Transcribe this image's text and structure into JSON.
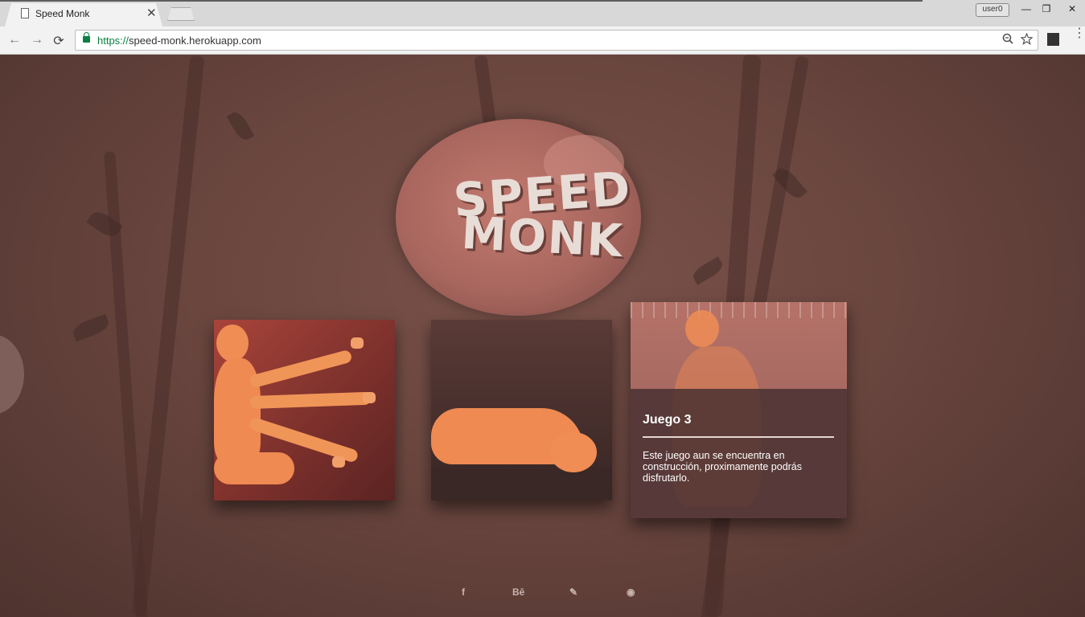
{
  "browser": {
    "tab_title": "Speed Monk",
    "tab_close": "✕",
    "user_badge": "user0",
    "window_controls": {
      "minimize": "—",
      "restore": "❐",
      "close": "✕"
    },
    "nav": {
      "back": "←",
      "forward": "→",
      "reload": "⟳"
    },
    "url_scheme": "https://",
    "url_rest": "speed-monk.herokuapp.com",
    "zoom_icon": "zoom-icon",
    "star_icon": "star-icon",
    "menu_icon": "⋮"
  },
  "logo": {
    "line1": "SPEED",
    "line2": "MONK"
  },
  "cards": [
    {
      "id": "juego-1"
    },
    {
      "id": "juego-2"
    },
    {
      "id": "juego-3",
      "title": "Juego 3",
      "description": "Este juego aun se encuentra en construcción, proximamente podrás disfrutarlo."
    }
  ],
  "social": [
    {
      "name": "facebook-icon",
      "glyph": "f"
    },
    {
      "name": "behance-icon",
      "glyph": "Bē"
    },
    {
      "name": "tools-icon",
      "glyph": "✎"
    },
    {
      "name": "globe-icon",
      "glyph": "◉"
    }
  ]
}
